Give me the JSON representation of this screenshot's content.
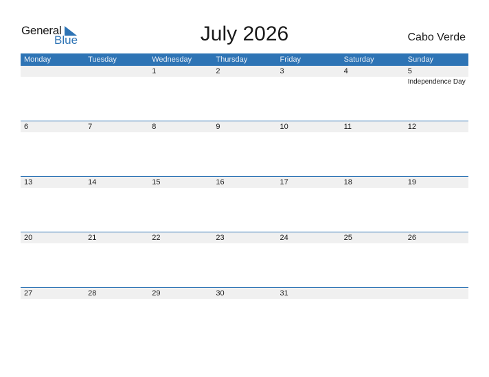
{
  "logo": {
    "part1": "General",
    "part2": "Blue",
    "icon": "triangle-flag-icon"
  },
  "title": "July 2026",
  "country": "Cabo Verde",
  "colors": {
    "accent": "#2e74b5",
    "band": "#f0f0f0"
  },
  "weekdays": [
    "Monday",
    "Tuesday",
    "Wednesday",
    "Thursday",
    "Friday",
    "Saturday",
    "Sunday"
  ],
  "weeks": [
    {
      "days": [
        {
          "d": ""
        },
        {
          "d": ""
        },
        {
          "d": "1"
        },
        {
          "d": "2"
        },
        {
          "d": "3"
        },
        {
          "d": "4"
        },
        {
          "d": "5",
          "event": "Independence Day"
        }
      ]
    },
    {
      "days": [
        {
          "d": "6"
        },
        {
          "d": "7"
        },
        {
          "d": "8"
        },
        {
          "d": "9"
        },
        {
          "d": "10"
        },
        {
          "d": "11"
        },
        {
          "d": "12"
        }
      ]
    },
    {
      "days": [
        {
          "d": "13"
        },
        {
          "d": "14"
        },
        {
          "d": "15"
        },
        {
          "d": "16"
        },
        {
          "d": "17"
        },
        {
          "d": "18"
        },
        {
          "d": "19"
        }
      ]
    },
    {
      "days": [
        {
          "d": "20"
        },
        {
          "d": "21"
        },
        {
          "d": "22"
        },
        {
          "d": "23"
        },
        {
          "d": "24"
        },
        {
          "d": "25"
        },
        {
          "d": "26"
        }
      ]
    },
    {
      "days": [
        {
          "d": "27"
        },
        {
          "d": "28"
        },
        {
          "d": "29"
        },
        {
          "d": "30"
        },
        {
          "d": "31"
        },
        {
          "d": ""
        },
        {
          "d": ""
        }
      ]
    }
  ]
}
